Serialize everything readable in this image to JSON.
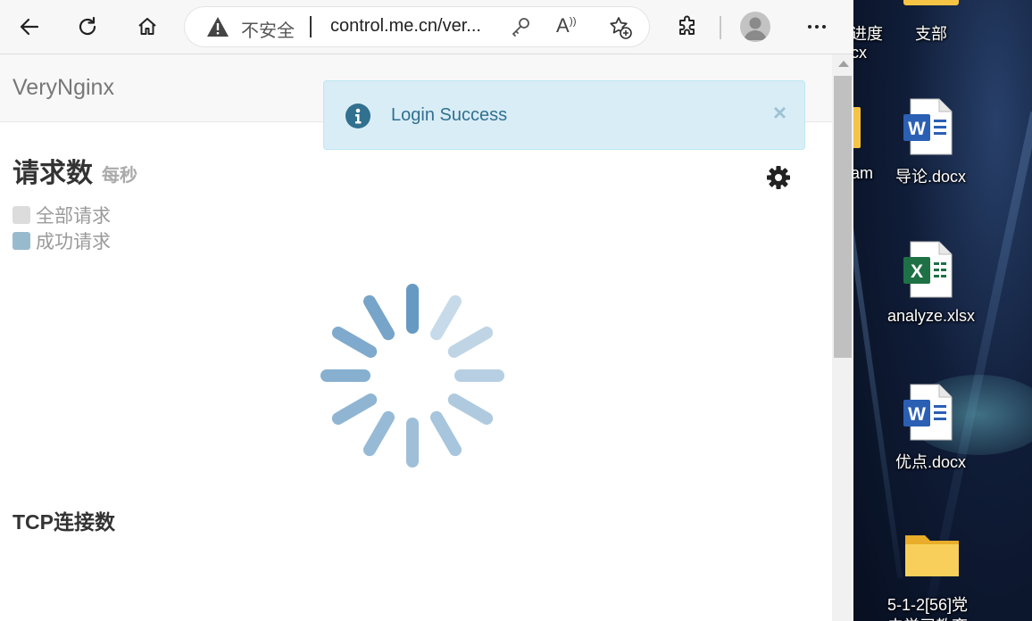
{
  "browser": {
    "address_bar": {
      "security_text": "不安全",
      "url": "control.me.cn/ver..."
    },
    "reader_mode_glyph": "Aͅ"
  },
  "page": {
    "brand": "VeryNginx",
    "alert": {
      "message": "Login Success",
      "close_glyph": "×"
    },
    "requests_panel": {
      "title": "请求数",
      "subtitle": "每秒",
      "legend": [
        {
          "label": "全部请求",
          "color": "#dcdcdc"
        },
        {
          "label": "成功请求",
          "color": "#97bbcd"
        }
      ]
    },
    "tcp_panel": {
      "title": "TCP连接数"
    }
  },
  "desktop": {
    "items": [
      {
        "label": "进度",
        "icon": "word-icon"
      },
      {
        "label": "cx",
        "icon": "none"
      },
      {
        "label": "支部",
        "icon": "folder-icon"
      },
      {
        "label": "am",
        "icon": "folder-icon"
      },
      {
        "label": "导论.docx",
        "icon": "word-icon"
      },
      {
        "label": "analyze.xlsx",
        "icon": "excel-icon"
      },
      {
        "label": "优点.docx",
        "icon": "word-icon"
      },
      {
        "label": "5-1-2[56]党",
        "icon": "folder-icon"
      },
      {
        "label": "史学习教育",
        "icon": "none"
      }
    ]
  },
  "colors": {
    "accent": "#31708f",
    "alert_bg": "#d9edf7",
    "spinner": "#5f95c0",
    "word": "#2b5fb4",
    "excel": "#1e7145",
    "folder": "#f5c445"
  }
}
